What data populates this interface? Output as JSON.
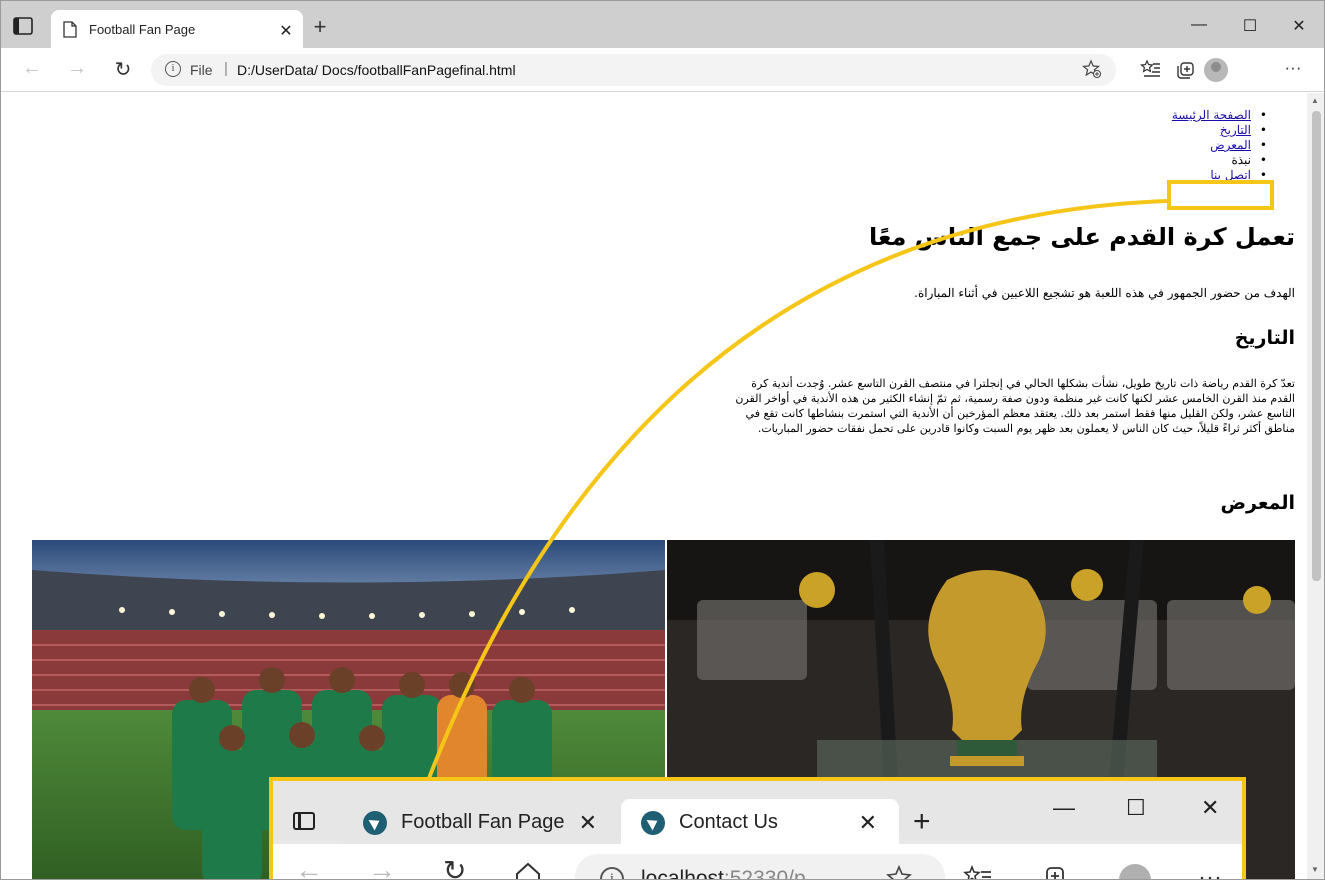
{
  "window": {
    "tab_title": "Football Fan Page",
    "tab_close": "✕",
    "new_tab": "+",
    "minimize": "—",
    "maximize": "☐",
    "close": "✕"
  },
  "toolbar": {
    "back": "←",
    "forward": "→",
    "reload": "↻",
    "scheme_label": "File",
    "separator": "|",
    "url": "D:/UserData/ Docs/footballFanPagefinal.html",
    "more": "···"
  },
  "page": {
    "nav": [
      "الصفحة الرئيسة",
      "التاريخ",
      "المعرض",
      "نبذة",
      "اتصل بنا"
    ],
    "heading": "تعمل كرة القدم على جمع الناس معًا",
    "intro": "الهدف من حضور الجمهور في هذه اللعبة هو تشجيع اللاعبين في أثناء المباراة.",
    "history_heading": "التاريخ",
    "history_text": "تعدّ كرة القدم رياضة ذات تاريخ طويل، نشأت بشكلها الحالي في إنجلترا في منتصف القرن التاسع عشر. وُجدت أندية كرة القدم منذ القرن الخامس عشر لكنها كانت غير منظمة ودون صفة رسمية، ثم تمّ إنشاء الكثير من هذه الأندية في أواخر القرن التاسع عشر، ولكن القليل منها فقط استمر بعد ذلك. يعتقد معظم المؤرخين أن الأندية التي استمرت بنشاطها كانت تقع في مناطق أكثر ثراءً قليلاً، حيث كان الناس لا يعملون بعد ظهر يوم السبت وكانوا قادرين على تحمل نفقات حضور المباريات.",
    "gallery_heading": "المعرض"
  },
  "callout": {
    "tab1_title": "Football Fan Page",
    "tab2_title": "Contact Us",
    "tab_close": "✕",
    "new_tab": "+",
    "url_host": "localhost",
    "url_rest": ":52330/p"
  },
  "colors": {
    "highlight": "#f5c518",
    "link": "#1a0dab"
  }
}
